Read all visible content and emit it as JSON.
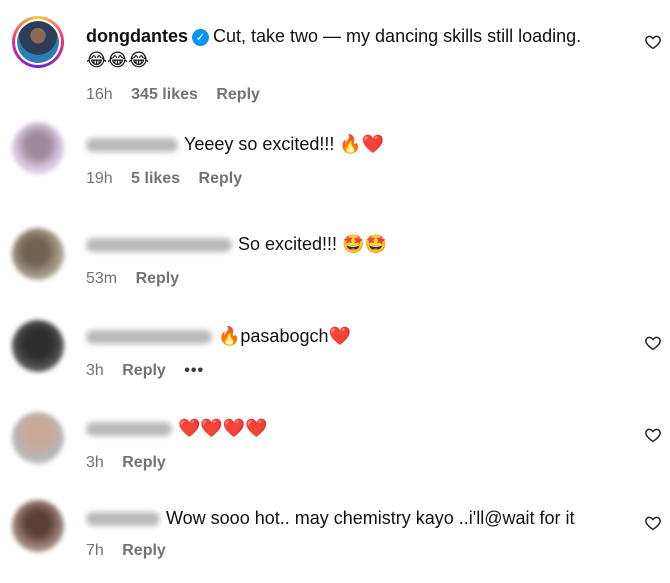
{
  "comments": [
    {
      "username": "dongdantes",
      "verified": true,
      "text": "Cut, take two — my dancing skills still loading.",
      "text_line2": "😂😂😂",
      "time": "16h",
      "likes": "345 likes",
      "reply": "Reply"
    },
    {
      "username_blurred": true,
      "text": "Yeeey so excited!!! 🔥❤️",
      "time": "19h",
      "likes": "5 likes",
      "reply": "Reply"
    },
    {
      "username_blurred": true,
      "text": "So excited!!! 🤩🤩",
      "time": "53m",
      "reply": "Reply"
    },
    {
      "username_blurred": true,
      "text": "🔥pasabogch❤️",
      "time": "3h",
      "reply": "Reply",
      "more": "•••"
    },
    {
      "username_blurred": true,
      "text": "❤️❤️❤️❤️",
      "time": "3h",
      "reply": "Reply"
    },
    {
      "username_blurred": true,
      "text": "Wow sooo hot.. may chemistry kayo ..i'll@wait for it",
      "time": "7h",
      "reply": "Reply"
    }
  ],
  "icons": {
    "like": "heart-outline-icon",
    "verified": "verified-badge-icon",
    "more": "more-options-icon"
  },
  "colors": {
    "verified": "#0095f6",
    "meta_text": "#737373",
    "text": "#111111"
  }
}
